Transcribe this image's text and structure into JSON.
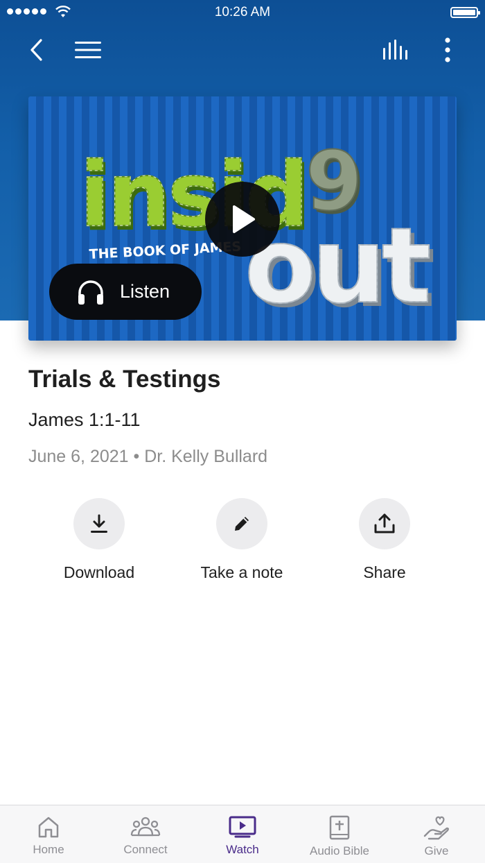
{
  "status_bar": {
    "time": "10:26 AM"
  },
  "media": {
    "artwork_description_text": [
      "insid",
      "9",
      "out",
      "THE BOOK OF JAMES"
    ],
    "listen_label": "Listen"
  },
  "sermon": {
    "title": "Trials & Testings",
    "scripture": "James 1:1-11",
    "meta": "June 6, 2021 • Dr. Kelly Bullard"
  },
  "actions": [
    {
      "label": "Download",
      "icon": "download-icon"
    },
    {
      "label": "Take a note",
      "icon": "pencil-icon"
    },
    {
      "label": "Share",
      "icon": "share-icon"
    }
  ],
  "tabs": [
    {
      "label": "Home",
      "icon": "home-icon",
      "active": false
    },
    {
      "label": "Connect",
      "icon": "people-icon",
      "active": false
    },
    {
      "label": "Watch",
      "icon": "tv-play-icon",
      "active": true
    },
    {
      "label": "Audio Bible",
      "icon": "bible-icon",
      "active": false
    },
    {
      "label": "Give",
      "icon": "heart-hand-icon",
      "active": false
    }
  ],
  "colors": {
    "header": "#135fa9",
    "active_tab": "#4a2c8a",
    "inactive_tab": "#8e8e93"
  }
}
